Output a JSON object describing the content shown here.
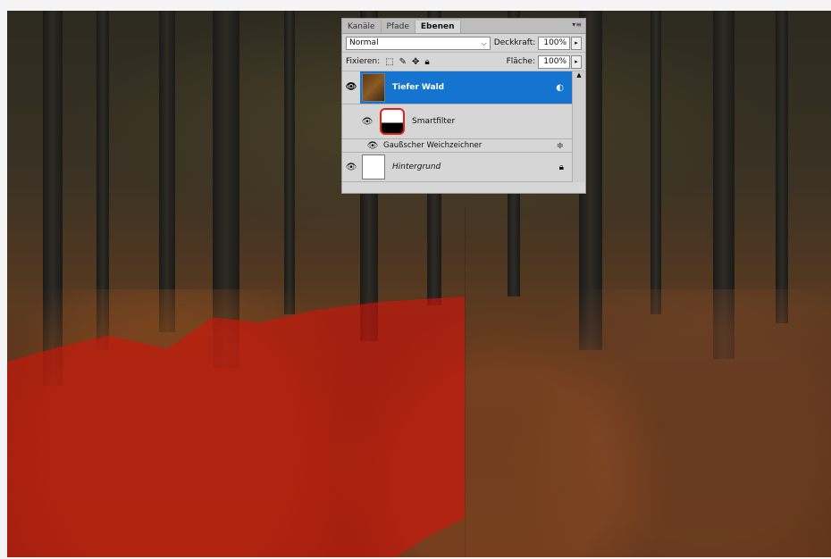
{
  "panel": {
    "tabs": [
      "Kanäle",
      "Pfade",
      "Ebenen"
    ],
    "active_tab": "Ebenen",
    "menu_icon": "panel-menu-icon",
    "blend_mode": "Normal",
    "opacity_label": "Deckkraft:",
    "opacity_value": "100%",
    "lock_label": "Fixieren:",
    "fill_label": "Fläche:",
    "fill_value": "100%",
    "layers": [
      {
        "name": "Tiefer Wald",
        "selected": true,
        "icons": [
          "eye-icon",
          "smart-object-icon",
          "filter-options-icon"
        ]
      },
      {
        "name": "Smartfilter",
        "selected": false,
        "icons": [
          "eye-icon",
          "filter-mask-thumbnail"
        ]
      },
      {
        "name": "Gaußscher Weichzeichner",
        "selected": false,
        "icons": [
          "eye-icon",
          "filter-blend-options-icon"
        ]
      },
      {
        "name": "Hintergrund",
        "selected": false,
        "icons": [
          "eye-icon",
          "lock-icon"
        ]
      }
    ]
  },
  "colors": {
    "selected_layer": "#1674d1",
    "mask_overlay": "#d2140a",
    "highlight_ring": "#e0201a"
  }
}
